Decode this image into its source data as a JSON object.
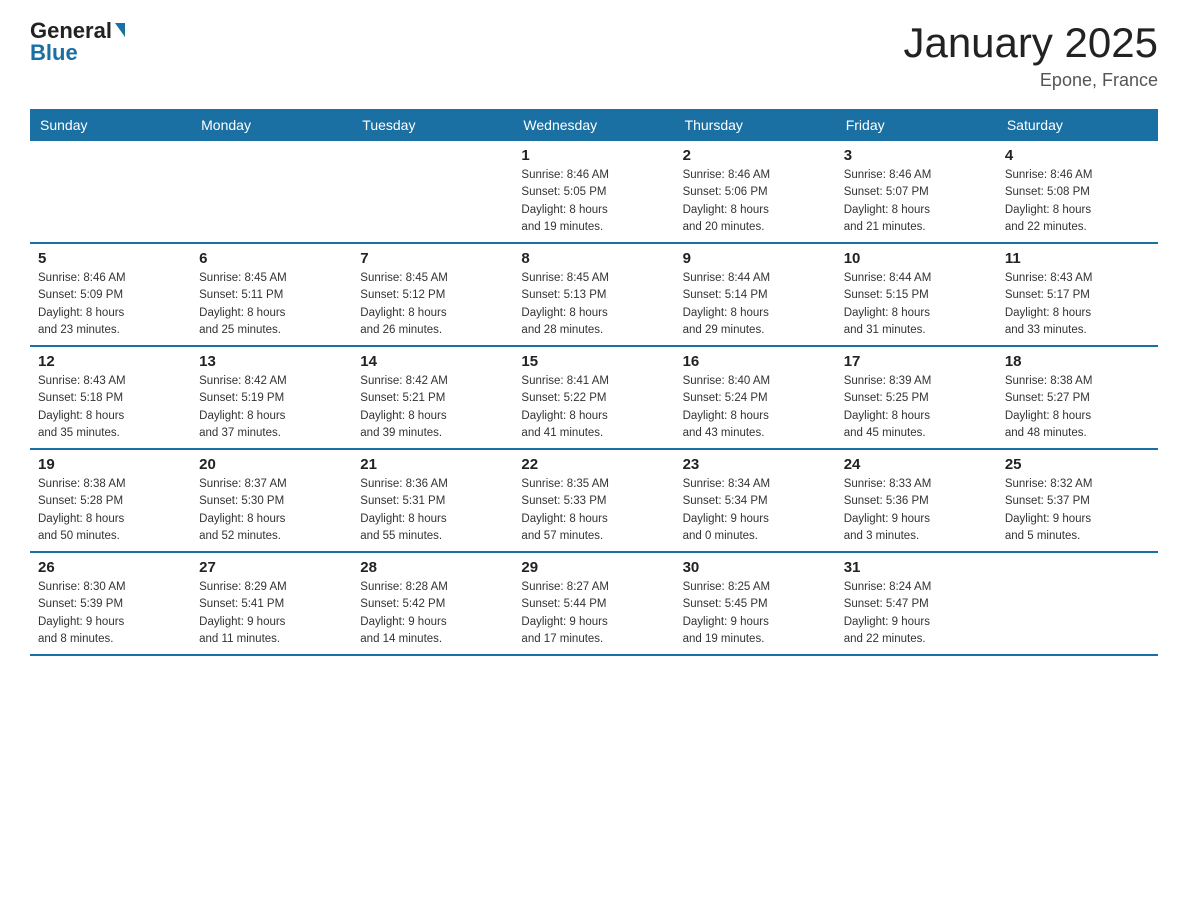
{
  "logo": {
    "general": "General",
    "blue": "Blue"
  },
  "header": {
    "title": "January 2025",
    "location": "Epone, France"
  },
  "days_of_week": [
    "Sunday",
    "Monday",
    "Tuesday",
    "Wednesday",
    "Thursday",
    "Friday",
    "Saturday"
  ],
  "weeks": [
    [
      {
        "day": "",
        "info": ""
      },
      {
        "day": "",
        "info": ""
      },
      {
        "day": "",
        "info": ""
      },
      {
        "day": "1",
        "info": "Sunrise: 8:46 AM\nSunset: 5:05 PM\nDaylight: 8 hours\nand 19 minutes."
      },
      {
        "day": "2",
        "info": "Sunrise: 8:46 AM\nSunset: 5:06 PM\nDaylight: 8 hours\nand 20 minutes."
      },
      {
        "day": "3",
        "info": "Sunrise: 8:46 AM\nSunset: 5:07 PM\nDaylight: 8 hours\nand 21 minutes."
      },
      {
        "day": "4",
        "info": "Sunrise: 8:46 AM\nSunset: 5:08 PM\nDaylight: 8 hours\nand 22 minutes."
      }
    ],
    [
      {
        "day": "5",
        "info": "Sunrise: 8:46 AM\nSunset: 5:09 PM\nDaylight: 8 hours\nand 23 minutes."
      },
      {
        "day": "6",
        "info": "Sunrise: 8:45 AM\nSunset: 5:11 PM\nDaylight: 8 hours\nand 25 minutes."
      },
      {
        "day": "7",
        "info": "Sunrise: 8:45 AM\nSunset: 5:12 PM\nDaylight: 8 hours\nand 26 minutes."
      },
      {
        "day": "8",
        "info": "Sunrise: 8:45 AM\nSunset: 5:13 PM\nDaylight: 8 hours\nand 28 minutes."
      },
      {
        "day": "9",
        "info": "Sunrise: 8:44 AM\nSunset: 5:14 PM\nDaylight: 8 hours\nand 29 minutes."
      },
      {
        "day": "10",
        "info": "Sunrise: 8:44 AM\nSunset: 5:15 PM\nDaylight: 8 hours\nand 31 minutes."
      },
      {
        "day": "11",
        "info": "Sunrise: 8:43 AM\nSunset: 5:17 PM\nDaylight: 8 hours\nand 33 minutes."
      }
    ],
    [
      {
        "day": "12",
        "info": "Sunrise: 8:43 AM\nSunset: 5:18 PM\nDaylight: 8 hours\nand 35 minutes."
      },
      {
        "day": "13",
        "info": "Sunrise: 8:42 AM\nSunset: 5:19 PM\nDaylight: 8 hours\nand 37 minutes."
      },
      {
        "day": "14",
        "info": "Sunrise: 8:42 AM\nSunset: 5:21 PM\nDaylight: 8 hours\nand 39 minutes."
      },
      {
        "day": "15",
        "info": "Sunrise: 8:41 AM\nSunset: 5:22 PM\nDaylight: 8 hours\nand 41 minutes."
      },
      {
        "day": "16",
        "info": "Sunrise: 8:40 AM\nSunset: 5:24 PM\nDaylight: 8 hours\nand 43 minutes."
      },
      {
        "day": "17",
        "info": "Sunrise: 8:39 AM\nSunset: 5:25 PM\nDaylight: 8 hours\nand 45 minutes."
      },
      {
        "day": "18",
        "info": "Sunrise: 8:38 AM\nSunset: 5:27 PM\nDaylight: 8 hours\nand 48 minutes."
      }
    ],
    [
      {
        "day": "19",
        "info": "Sunrise: 8:38 AM\nSunset: 5:28 PM\nDaylight: 8 hours\nand 50 minutes."
      },
      {
        "day": "20",
        "info": "Sunrise: 8:37 AM\nSunset: 5:30 PM\nDaylight: 8 hours\nand 52 minutes."
      },
      {
        "day": "21",
        "info": "Sunrise: 8:36 AM\nSunset: 5:31 PM\nDaylight: 8 hours\nand 55 minutes."
      },
      {
        "day": "22",
        "info": "Sunrise: 8:35 AM\nSunset: 5:33 PM\nDaylight: 8 hours\nand 57 minutes."
      },
      {
        "day": "23",
        "info": "Sunrise: 8:34 AM\nSunset: 5:34 PM\nDaylight: 9 hours\nand 0 minutes."
      },
      {
        "day": "24",
        "info": "Sunrise: 8:33 AM\nSunset: 5:36 PM\nDaylight: 9 hours\nand 3 minutes."
      },
      {
        "day": "25",
        "info": "Sunrise: 8:32 AM\nSunset: 5:37 PM\nDaylight: 9 hours\nand 5 minutes."
      }
    ],
    [
      {
        "day": "26",
        "info": "Sunrise: 8:30 AM\nSunset: 5:39 PM\nDaylight: 9 hours\nand 8 minutes."
      },
      {
        "day": "27",
        "info": "Sunrise: 8:29 AM\nSunset: 5:41 PM\nDaylight: 9 hours\nand 11 minutes."
      },
      {
        "day": "28",
        "info": "Sunrise: 8:28 AM\nSunset: 5:42 PM\nDaylight: 9 hours\nand 14 minutes."
      },
      {
        "day": "29",
        "info": "Sunrise: 8:27 AM\nSunset: 5:44 PM\nDaylight: 9 hours\nand 17 minutes."
      },
      {
        "day": "30",
        "info": "Sunrise: 8:25 AM\nSunset: 5:45 PM\nDaylight: 9 hours\nand 19 minutes."
      },
      {
        "day": "31",
        "info": "Sunrise: 8:24 AM\nSunset: 5:47 PM\nDaylight: 9 hours\nand 22 minutes."
      },
      {
        "day": "",
        "info": ""
      }
    ]
  ]
}
